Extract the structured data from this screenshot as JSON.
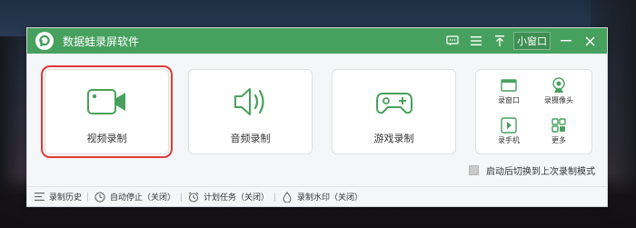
{
  "app": {
    "title": "数据蛙录屏软件",
    "mini_window_label": "小窗口",
    "accent": "#47a15e"
  },
  "titlebar_icons": [
    "chat-icon",
    "menu-icon",
    "pin-icon",
    "minimize-icon",
    "close-icon"
  ],
  "cards": [
    {
      "label": "视频录制",
      "icon": "video-camera-icon",
      "selected": true
    },
    {
      "label": "音频录制",
      "icon": "speaker-icon",
      "selected": false
    },
    {
      "label": "游戏录制",
      "icon": "gamepad-icon",
      "selected": false
    }
  ],
  "more_tools": [
    {
      "label": "录窗口",
      "icon": "window-icon"
    },
    {
      "label": "录摄像头",
      "icon": "webcam-icon"
    },
    {
      "label": "录手机",
      "icon": "phone-icon"
    },
    {
      "label": "更多",
      "icon": "more-grid-icon"
    }
  ],
  "startup_option": {
    "label": "启动后切换到上次录制模式",
    "checked": false
  },
  "statusbar": {
    "history": "录制历史",
    "auto_stop": "自动停止（关闭）",
    "schedule": "计划任务（关闭）",
    "watermark": "录制水印（关闭）"
  }
}
